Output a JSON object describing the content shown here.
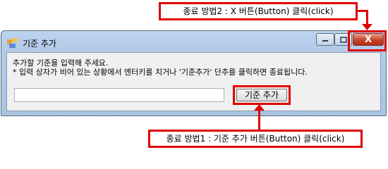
{
  "window": {
    "title": "기준 추가",
    "prompt_line1": "추가할 기준을 입력해 주세요.",
    "prompt_line2": "* 입력 상자가 비어 있는 상황에서 엔터키를 치거나 '기준추가' 단추를 클릭하면 종료됩니다.",
    "input_value": "",
    "ok_button_label": "기준 추가",
    "close_button_label": "X"
  },
  "annotations": {
    "top_callout": "종료 방법2 : X 버튼(Button)  클릭(click)",
    "bottom_callout": "종료 방법1 : 기준 추가 버튼(Button)  클릭(click)"
  },
  "colors": {
    "annotation_red": "#e00000",
    "titlebar_blue": "#b2cbe9",
    "close_red": "#c6442a"
  },
  "icons": [
    "app-icon",
    "minimize-icon",
    "maximize-icon",
    "close-icon",
    "arrow-up-icon",
    "arrow-down-icon"
  ]
}
